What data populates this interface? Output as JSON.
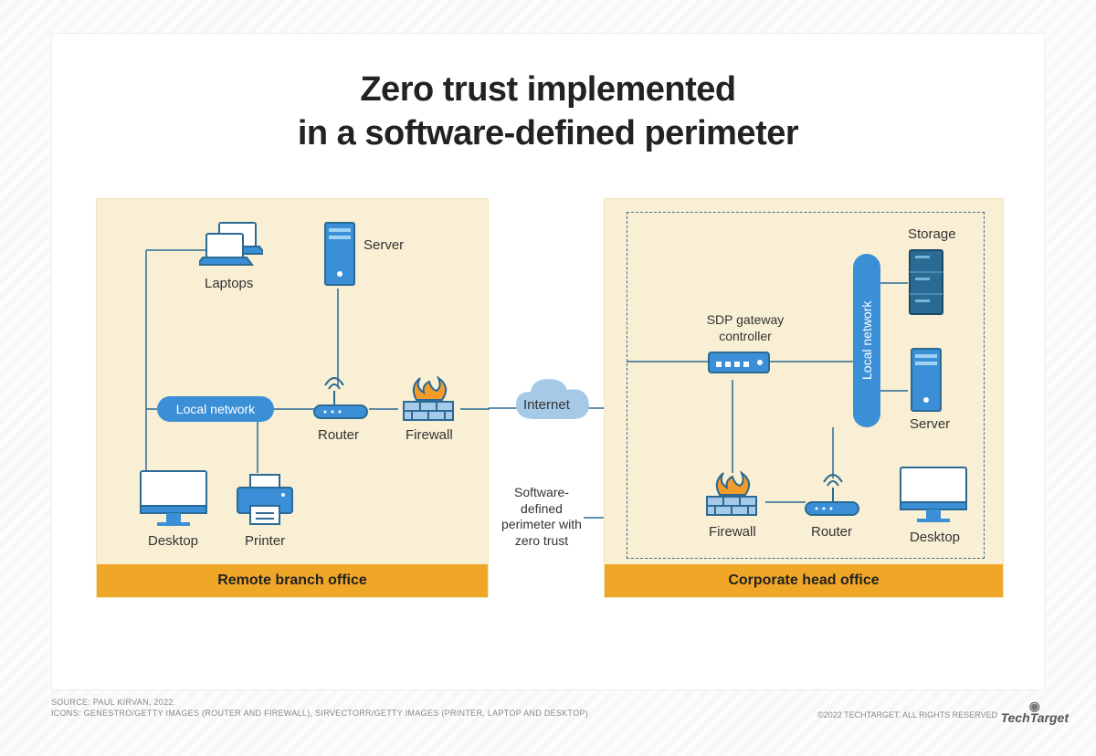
{
  "title_line1": "Zero trust implemented",
  "title_line2": "in a software-defined perimeter",
  "left_panel": {
    "footer": "Remote branch office",
    "local_network": "Local network",
    "labels": {
      "laptops": "Laptops",
      "server": "Server",
      "router": "Router",
      "firewall": "Firewall",
      "desktop": "Desktop",
      "printer": "Printer"
    }
  },
  "center": {
    "internet": "Internet",
    "sdp_note": "Software-\ndefined\nperimeter with\nzero trust"
  },
  "right_panel": {
    "footer": "Corporate head office",
    "local_network": "Local network",
    "labels": {
      "sdp_gateway": "SDP gateway\ncontroller",
      "storage": "Storage",
      "server": "Server",
      "firewall": "Firewall",
      "router": "Router",
      "desktop": "Desktop"
    }
  },
  "credits": {
    "source": "SOURCE: PAUL KIRVAN, 2022.",
    "icons": "ICONS: GENESTRO/GETTY IMAGES (ROUTER AND FIREWALL), SIRVECTORR/GETTY IMAGES (PRINTER, LAPTOP AND DESKTOP)"
  },
  "copyright": "©2022 TECHTARGET. ALL RIGHTS RESERVED",
  "logo": "TechTarget",
  "colors": {
    "line": "#2a6a94",
    "blue": "#3b8fd6",
    "cloud": "#a6c9e8"
  }
}
